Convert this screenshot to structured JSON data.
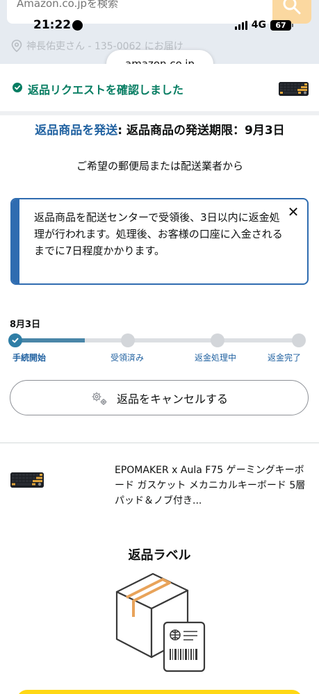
{
  "search": {
    "placeholder": "Amazon.co.jpを検索"
  },
  "status": {
    "time": "21:22",
    "network": "4G",
    "battery": "67"
  },
  "deliver_to": "神長佑吏さん - 135-0062 にお届け",
  "url": "amazon.co.jp",
  "confirmation": {
    "text": "返品リクエストを確認しました",
    "color": "#067d62"
  },
  "ship": {
    "link": "返品商品を発送",
    "colon": ":",
    "rest": " 返品商品の発送期限：9月3日",
    "subtitle": "ご希望の郵便局または配送業者から"
  },
  "info_box": {
    "text": "返品商品を配送センターで受領後、3日以内に返金処理が行われます。処理後、お客様の口座に入金されるまでに7日程度かかります。",
    "close_glyph": "✕",
    "accent": "#2f6cb0"
  },
  "tracker": {
    "date": "8月3日",
    "progress": 0.25,
    "steps": [
      {
        "label": "手続開始",
        "done": true
      },
      {
        "label": "受領済み",
        "done": false
      },
      {
        "label": "返金処理中",
        "done": false
      },
      {
        "label": "返金完了",
        "done": false
      }
    ]
  },
  "cancel_button": {
    "label": "返品をキャンセルする",
    "icon": "gear-icon"
  },
  "product": {
    "title": "EPOMAKER x Aula F75 ゲーミングキーボード ガスケット メカニカルキーボード 5層パッド＆ノブ付き..."
  },
  "return_label": {
    "heading": "返品ラベル"
  }
}
